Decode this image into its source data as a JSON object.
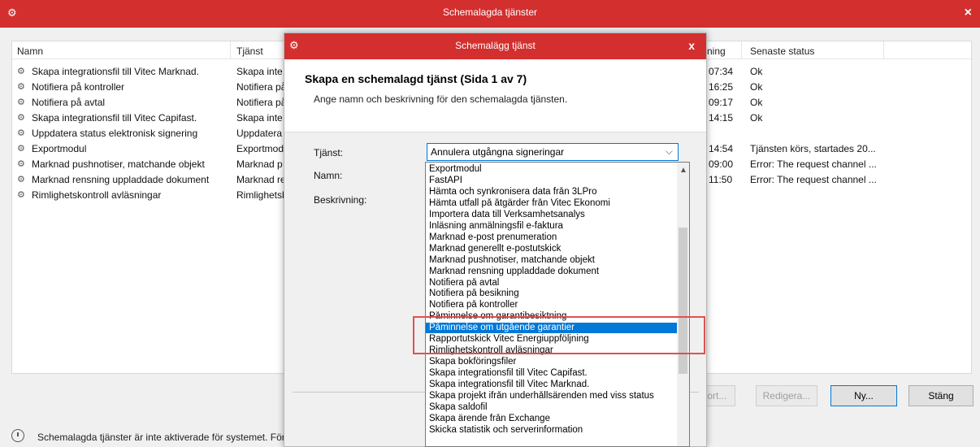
{
  "main_window": {
    "title": "Schemalagda tjänster",
    "close_glyph": "×"
  },
  "list": {
    "columns": {
      "name": "Namn",
      "service": "Tjänst",
      "next_run": "ning",
      "last_status": "Senaste status"
    },
    "rows": [
      {
        "name": "Skapa integrationsfil till Vitec Marknad.",
        "service": "Skapa inte",
        "time": "07:34",
        "status": "Ok"
      },
      {
        "name": "Notifiera på kontroller",
        "service": "Notifiera på",
        "time": "16:25",
        "status": "Ok"
      },
      {
        "name": "Notifiera på avtal",
        "service": "Notifiera på",
        "time": "09:17",
        "status": "Ok"
      },
      {
        "name": "Skapa integrationsfil till Vitec Capifast.",
        "service": "Skapa inte",
        "time": "14:15",
        "status": "Ok"
      },
      {
        "name": "Uppdatera status elektronisk signering",
        "service": "Uppdatera",
        "time": "",
        "status": ""
      },
      {
        "name": "Exportmodul",
        "service": "Exportmodu",
        "time": "14:54",
        "status": "Tjänsten körs, startades 20..."
      },
      {
        "name": "Marknad pushnotiser, matchande objekt",
        "service": "Marknad p",
        "time": "09:00",
        "status": "Error: The request channel ..."
      },
      {
        "name": "Marknad rensning uppladdade dokument",
        "service": "Marknad re",
        "time": "11:50",
        "status": "Error: The request channel ..."
      },
      {
        "name": "Rimlighetskontroll avläsningar",
        "service": "Rimlighetsk",
        "time": "",
        "status": ""
      }
    ]
  },
  "buttons": {
    "export": "port...",
    "edit": "Redigera...",
    "new": "Ny...",
    "close": "Stäng"
  },
  "status_bar": {
    "text": "Schemalagda tjänster är inte aktiverade för systemet. För att aktivera gå till Meny-Installni"
  },
  "dialog": {
    "title": "Schemalägg tjänst",
    "close_glyph": "x",
    "heading": "Skapa en schemalagd tjänst (Sida 1 av 7)",
    "subheading": "Ange namn och beskrivning för den schemalagda tjänsten.",
    "label_service": "Tjänst:",
    "label_name": "Namn:",
    "label_description": "Beskrivning:",
    "combo_value": "Annulera utgångna signeringar"
  },
  "dropdown": {
    "items": [
      "Exportmodul",
      "FastAPI",
      "Hämta och synkronisera data från 3LPro",
      "Hämta utfall på åtgärder från Vitec Ekonomi",
      "Importera data till Verksamhetsanalys",
      "Inläsning anmälningsfil e-faktura",
      "Marknad e-post prenumeration",
      "Marknad generellt e-postutskick",
      "Marknad pushnotiser, matchande objekt",
      "Marknad rensning uppladdade dokument",
      "Notifiera på avtal",
      "Notifiera på besikning",
      "Notifiera på kontroller",
      "Påminnelse om garantibesiktning",
      "Påminnelse om utgående garantier",
      "Rapportutskick Vitec Energiuppföljning",
      "Rimlighetskontroll avläsningar",
      "Skapa bokföringsfiler",
      "Skapa integrationsfil till Vitec Capifast.",
      "Skapa integrationsfil till Vitec Marknad.",
      "Skapa projekt ifrån underhållsärenden med viss status",
      "Skapa saldofil",
      "Skapa ärende från Exchange",
      "Skicka statistik och serverinformation"
    ],
    "selected_index": 14
  },
  "colors": {
    "titlebar": "#d32f2f",
    "selection": "#0078d7",
    "highlight_box": "#e05050"
  }
}
